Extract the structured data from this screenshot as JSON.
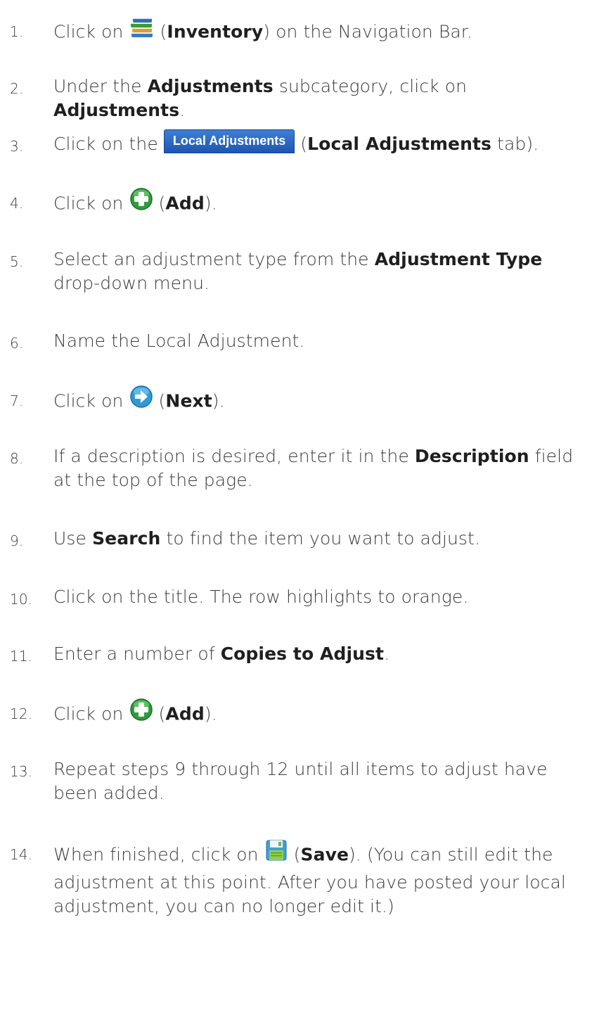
{
  "steps": [
    {
      "num": "1.",
      "pre": "Click on ",
      "icon": "inventory-books-icon",
      "mid": " (",
      "bold1": "Inventory",
      "post": ") on the Navigation Bar."
    },
    {
      "num": "2.",
      "pre": "Under the ",
      "bold1": "Adjustments",
      "mid": " subcategory, click on ",
      "bold2": "Adjustments",
      "post": "."
    },
    {
      "num": "3.",
      "pre": "Click on the ",
      "tab_label": "Local Adjustments",
      "mid": " (",
      "bold1": "Local Adjustments",
      "post": " tab)."
    },
    {
      "num": "4.",
      "pre": "Click on ",
      "icon": "add-plus-icon",
      "mid": " (",
      "bold1": "Add",
      "post": ")."
    },
    {
      "num": "5.",
      "pre": "Select an adjustment type from the ",
      "bold1": "Adjustment Type",
      "post": " drop-down menu."
    },
    {
      "num": "6.",
      "pre": "Name the Local Adjustment."
    },
    {
      "num": "7.",
      "pre": "Click on ",
      "icon": "next-arrow-icon",
      "mid": " (",
      "bold1": "Next",
      "post": ")."
    },
    {
      "num": "8.",
      "pre": "If a description is desired, enter it in the ",
      "bold1": "Description",
      "post": " field at the top of the page."
    },
    {
      "num": "9.",
      "pre": "Use ",
      "bold1": "Search",
      "post": " to find the item you want to adjust."
    },
    {
      "num": "10.",
      "pre": "Click on the title. The row highlights to orange."
    },
    {
      "num": "11.",
      "pre": "Enter a number of ",
      "bold1": "Copies to Adjust",
      "post": "."
    },
    {
      "num": "12.",
      "pre": "Click on ",
      "icon": "add-plus-icon",
      "mid": " (",
      "bold1": "Add",
      "post": ")."
    },
    {
      "num": "13.",
      "pre": "Repeat steps 9 through 12 until all items to adjust have been added."
    },
    {
      "num": "14.",
      "pre": "When finished, click on ",
      "icon": "save-floppy-icon",
      "mid": " (",
      "bold1": "Save",
      "post": "). (You can still edit the adjustment at this point.  After you have posted your local adjustment, you can no longer edit it.)"
    }
  ]
}
